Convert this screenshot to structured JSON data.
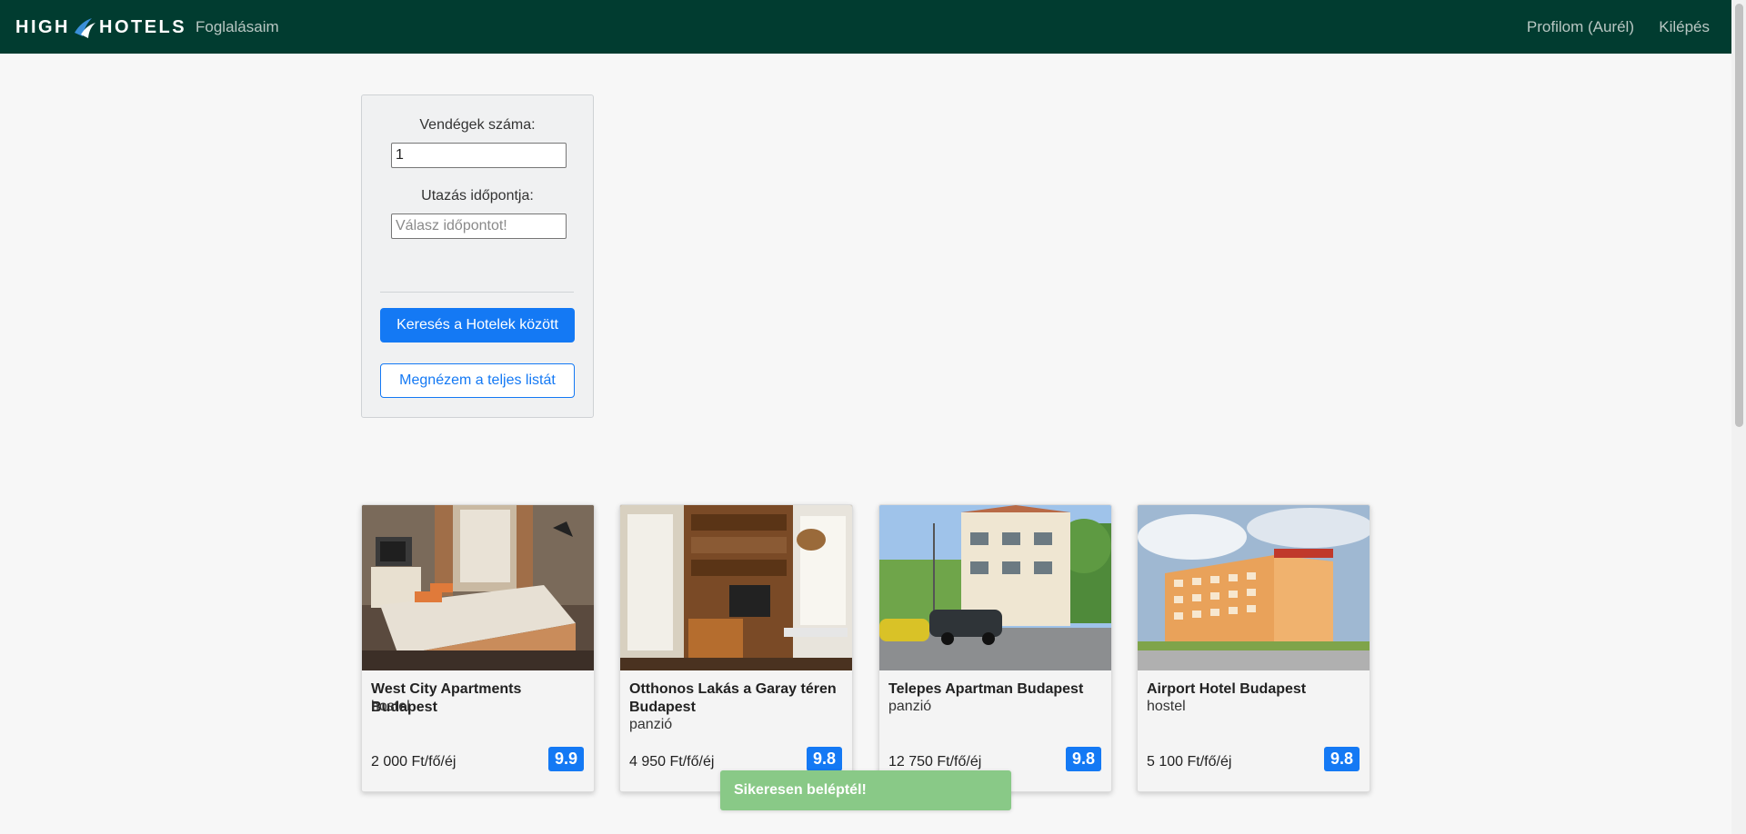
{
  "navbar": {
    "brand_left": "HIGH",
    "brand_right": "HOTELS",
    "bookings_link": "Foglalásaim",
    "profile_link": "Profilom (Aurél)",
    "logout_link": "Kilépés"
  },
  "search": {
    "guests_label": "Vendégek száma:",
    "guests_value": "1",
    "date_label": "Utazás időpontja:",
    "date_placeholder": "Válasz időpontot!",
    "search_button": "Keresés a Hotelek között",
    "full_list_button": "Megnézem a teljes listát"
  },
  "hotels": [
    {
      "name": "West City Apartments Budapest",
      "type": "hostel",
      "price": "2 000 Ft/fő/éj",
      "rating": "9.9"
    },
    {
      "name": "Otthonos Lakás a Garay téren Budapest",
      "type": "panzió",
      "price": "4 950 Ft/fő/éj",
      "rating": "9.8"
    },
    {
      "name": "Telepes Apartman Budapest",
      "type": "panzió",
      "price": "12 750 Ft/fő/éj",
      "rating": "9.8"
    },
    {
      "name": "Airport Hotel Budapest",
      "type": "hostel",
      "price": "5 100 Ft/fő/éj",
      "rating": "9.8"
    }
  ],
  "toast": {
    "message": "Sikeresen beléptél!"
  },
  "colors": {
    "navbar": "#013c30",
    "primary": "#1479f4",
    "toast": "#89c987",
    "background": "#f7f7f7"
  }
}
